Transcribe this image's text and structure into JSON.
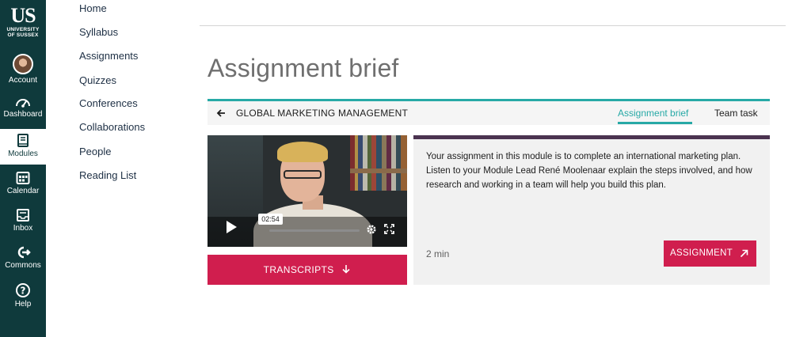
{
  "global_nav": {
    "logo_mark": "US",
    "logo_line1": "UNIVERSITY",
    "logo_line2": "OF SUSSEX",
    "items": [
      {
        "label": "Account",
        "icon": "avatar"
      },
      {
        "label": "Dashboard",
        "icon": "dashboard-icon"
      },
      {
        "label": "Modules",
        "icon": "book-icon"
      },
      {
        "label": "Calendar",
        "icon": "calendar-icon"
      },
      {
        "label": "Inbox",
        "icon": "inbox-icon"
      },
      {
        "label": "Commons",
        "icon": "commons-icon"
      },
      {
        "label": "Help",
        "icon": "help-icon"
      }
    ],
    "active_item": "Modules"
  },
  "course_nav": {
    "links": [
      "Home",
      "Syllabus",
      "Assignments",
      "Quizzes",
      "Conferences",
      "Collaborations",
      "People",
      "Reading List"
    ]
  },
  "page": {
    "title": "Assignment brief"
  },
  "panel": {
    "course_name": "GLOBAL MARKETING MANAGEMENT",
    "tabs": [
      {
        "label": "Assignment brief",
        "active": true
      },
      {
        "label": "Team task",
        "active": false
      }
    ],
    "video": {
      "timestamp": "02:54"
    },
    "transcripts_label": "TRANSCRIPTS",
    "description": "Your assignment in this module is to complete an international marketing plan. Listen to your Module Lead René Moolenaar explain the steps involved, and how research and working in a team will help you build this plan.",
    "duration": "2 min",
    "assignment_label": "ASSIGNMENT"
  },
  "colors": {
    "nav_bg": "#0f3a3c",
    "accent_teal": "#27a9a6",
    "button_red": "#d01e4e",
    "card_top": "#4b3350"
  }
}
